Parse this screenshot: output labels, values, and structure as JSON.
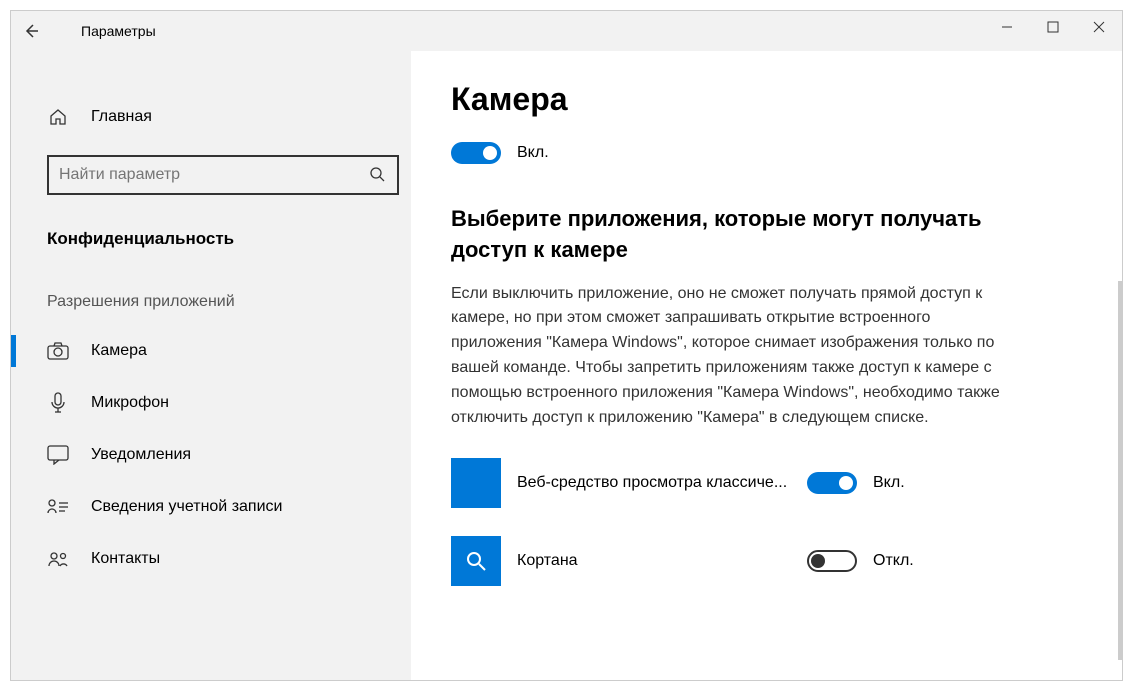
{
  "window": {
    "title": "Параметры"
  },
  "sidebar": {
    "home": "Главная",
    "search_placeholder": "Найти параметр",
    "category": "Конфиденциальность",
    "section_header": "Разрешения приложений",
    "items": [
      {
        "label": "Камера"
      },
      {
        "label": "Микрофон"
      },
      {
        "label": "Уведомления"
      },
      {
        "label": "Сведения учетной записи"
      },
      {
        "label": "Контакты"
      }
    ]
  },
  "main": {
    "title": "Камера",
    "master_toggle": {
      "state": "on",
      "label": "Вкл."
    },
    "sub_title": "Выберите приложения, которые могут получать доступ к камере",
    "description": "Если выключить приложение, оно не сможет получать прямой доступ к камере, но при этом сможет запрашивать открытие встроенного приложения \"Камера Windows\", которое снимает изображения только по вашей команде. Чтобы запретить приложениям также доступ к камере с помощью встроенного приложения \"Камера Windows\", необходимо также отключить доступ к приложению \"Камера\" в следующем списке.",
    "apps": [
      {
        "name": "Веб-средство просмотра классиче...",
        "state": "on",
        "state_label": "Вкл."
      },
      {
        "name": "Кортана",
        "state": "off",
        "state_label": "Откл."
      }
    ]
  }
}
